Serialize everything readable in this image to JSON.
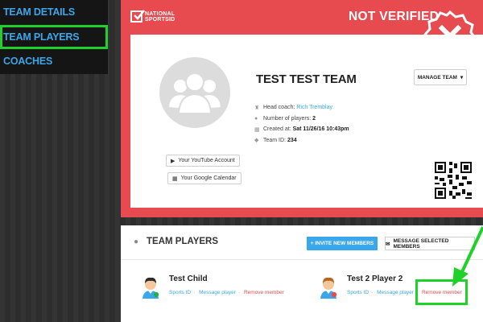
{
  "sidebar": {
    "items": [
      {
        "label": "TEAM DETAILS"
      },
      {
        "label": "TEAM PLAYERS"
      },
      {
        "label": "COACHES"
      }
    ]
  },
  "brand": {
    "line1": "NATIONAL",
    "line2": "SPORTSID"
  },
  "status": "NOT VERIFIED",
  "team": {
    "name": "TEST TEST TEAM",
    "manage_label": "MANAGE TEAM",
    "head_coach_label": "Head coach:",
    "head_coach": "Rich Tremblay",
    "players_label": "Number of players:",
    "players_count": "2",
    "created_label": "Created at:",
    "created_at": "Sat 11/26/16 10:43pm",
    "team_id_label": "Team ID:",
    "team_id": "234",
    "youtube_label": "Your YouTube Account",
    "calendar_label": "Your Google Calendar"
  },
  "players_panel": {
    "title": "TEAM PLAYERS",
    "invite_label": "+ INVITE NEW MEMBERS",
    "message_label": "MESSAGE SELECTED MEMBERS",
    "players": [
      {
        "name": "Test Child",
        "sports_id": "Sports ID",
        "message": "Message player",
        "remove": "Remove member"
      },
      {
        "name": "Test 2 Player 2",
        "sports_id": "Sports ID",
        "message": "Message player",
        "remove": "Remove member"
      }
    ]
  },
  "colors": {
    "accent": "#3aa7ea",
    "danger": "#e84b4f",
    "highlight": "#1fd12a"
  }
}
